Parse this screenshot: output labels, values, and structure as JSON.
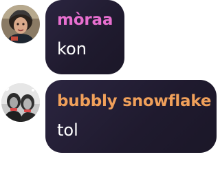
{
  "messages": [
    {
      "author": "mòraa",
      "text": "kon",
      "author_color": "#e86fd0",
      "avatar_icon": "user-avatar-photo"
    },
    {
      "author": "bubbly snowflake",
      "text": "tol",
      "author_color": "#f0a05a",
      "avatar_icon": "user-avatar-photo"
    }
  ],
  "colors": {
    "bubble": "#221c33",
    "text": "#ffffff",
    "background": "#ffffff"
  }
}
